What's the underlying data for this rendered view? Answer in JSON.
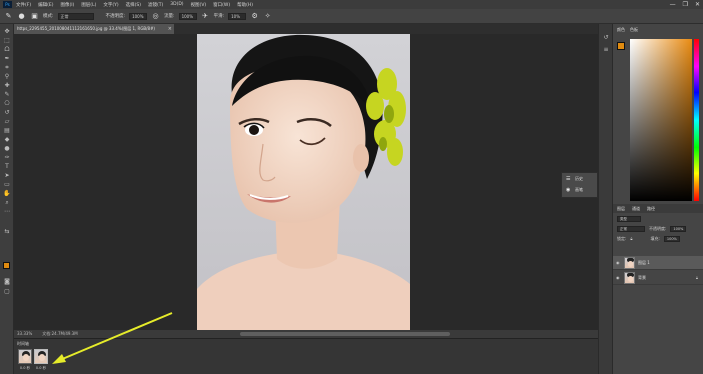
{
  "app": {
    "logo": "Ps",
    "menu": [
      "文件(F)",
      "编辑(E)",
      "图像(I)",
      "图层(L)",
      "文字(Y)",
      "选择(S)",
      "滤镜(T)",
      "3D(D)",
      "视图(V)",
      "窗口(W)",
      "帮助(H)"
    ],
    "window_controls": [
      "—",
      "❐",
      "✕"
    ]
  },
  "options_bar": {
    "tool_icon": "brush-icon",
    "mode_label": "模式:",
    "mode_value": "正常",
    "opacity_label": "不透明度:",
    "opacity_value": "100%",
    "flow_label": "流量:",
    "flow_value": "100%",
    "smoothing_label": "平滑:",
    "smoothing_value": "10%"
  },
  "document": {
    "tab_title": "https_2295455_201008041112161650.jpg @ 33.4%(图层 1, RGB/8#)",
    "close": "×"
  },
  "status": {
    "zoom": "33.33%",
    "doc_size": "文档:24.7M/49.3M"
  },
  "filmstrip": {
    "title": "时间轴",
    "thumbs": [
      {
        "label": "0.0 秒"
      },
      {
        "label": "0.0 秒"
      }
    ]
  },
  "mini_panel": {
    "items": [
      {
        "icon": "history-icon",
        "label": "历史"
      },
      {
        "icon": "brush-presets-icon",
        "label": "画笔"
      }
    ]
  },
  "color_panel": {
    "tabs": [
      "颜色",
      "色板"
    ],
    "fg_color": "#e08b10"
  },
  "layers_panel": {
    "tabs": [
      "图层",
      "通道",
      "路径"
    ],
    "kind_label": "类型",
    "blend_mode": "正常",
    "opacity_label": "不透明度:",
    "opacity_value": "100%",
    "lock_label": "锁定:",
    "fill_label": "填充:",
    "fill_value": "100%",
    "layers": [
      {
        "name": "图层 1",
        "active": true
      },
      {
        "name": "背景",
        "active": false
      }
    ]
  },
  "colors": {
    "accent": "#e08b10",
    "arrow": "#e6ec2a"
  }
}
